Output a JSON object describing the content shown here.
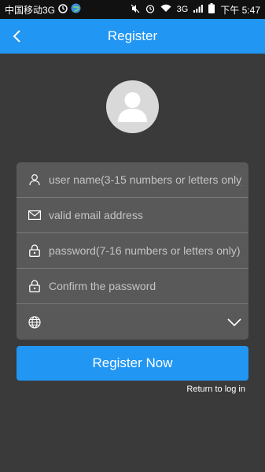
{
  "status_bar": {
    "carrier": "中国移动3G",
    "network": "3G",
    "time_label": "下午 5:47"
  },
  "header": {
    "title": "Register"
  },
  "form": {
    "username_placeholder": "user name(3-15 numbers or letters only)",
    "email_placeholder": "valid email address",
    "password_placeholder": "password(7-16 numbers or letters only)",
    "confirm_placeholder": "Confirm the password",
    "region_value": ""
  },
  "actions": {
    "register_label": "Register Now",
    "return_label": "Return to log in"
  },
  "colors": {
    "accent": "#2196f3",
    "background": "#3a3a3a",
    "form_bg": "#595959"
  },
  "icons": [
    "back-arrow-icon",
    "user-icon",
    "email-icon",
    "lock-icon",
    "globe-icon",
    "chevron-down-icon",
    "avatar-icon"
  ]
}
